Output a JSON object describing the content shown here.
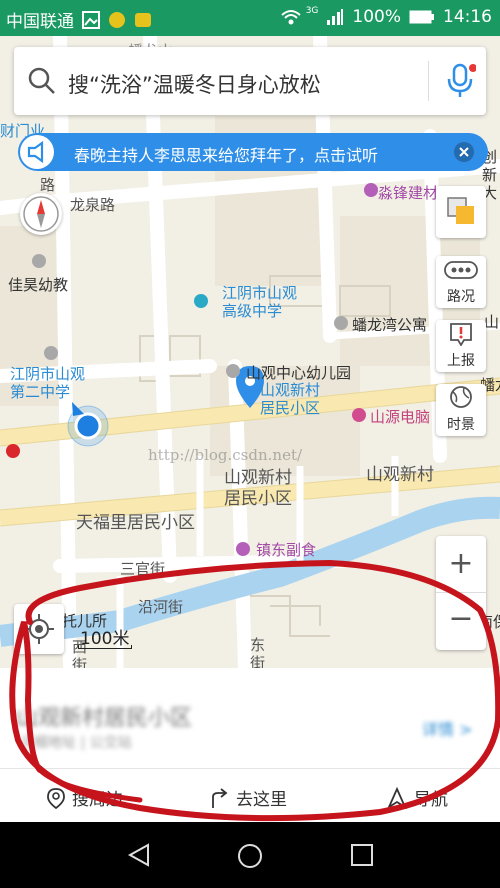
{
  "status": {
    "carrier": "中国联通",
    "network": "3G",
    "battery": "100%",
    "time": "14:16"
  },
  "search": {
    "placeholder": "搜“洗浴”温暖冬日身心放松"
  },
  "banner": {
    "text": "春晚主持人李思思来给您拜年了，点击试听"
  },
  "controls": {
    "traffic": "路况",
    "report": "上报",
    "timeview": "时景",
    "zoom_in": "+",
    "zoom_out": "−"
  },
  "scale": "100米",
  "map_labels": {
    "road_longquan": "龙泉路",
    "jiahao_kindergarten": "佳昊幼教",
    "shanguan_high": "江阴市山观\n高级中学",
    "panlongwan": "蟠龙湾公寓",
    "shanguan_kindergarten": "山观中心幼儿园",
    "school2": "江阴市山观\n第二中学",
    "xincun_pin": "山观新村\n居民小区",
    "shanyuan_pc": "山源电脑",
    "xincun_big": "山观新村\n居民小区",
    "xincun_right": "山观新村",
    "tianfuli": "天福里居民小区",
    "zhendong": "镇东副食",
    "sanguan": "三官街",
    "yanhe": "沿河街",
    "tuoer": "托儿所",
    "dongjie": "东\n街",
    "xijie": "西\n街",
    "miaofeng": "淼锋建材",
    "left_edge": "财门业",
    "road_edge": "路",
    "right_edge_chuang": "创\n新\n大",
    "right_edge_shan": "山",
    "panlong_edge": "蟠龙",
    "nanbao_edge": "南保",
    "top_edge": "蟠龙山"
  },
  "watermark": "http://blog.csdn.net/",
  "bottom_sheet": {
    "place_name": "山观新村居民小区",
    "place_sub": "详细地址  |  公交站",
    "detail_link": "详情 >"
  },
  "actions": {
    "nearby": "搜周边",
    "go_here": "去这里",
    "navigate": "导航"
  },
  "colors": {
    "status_bar": "#1a9a62",
    "accent_blue": "#2f8fe8",
    "annotation_red": "#c5141c",
    "road_yellow": "#f9e9b0"
  }
}
